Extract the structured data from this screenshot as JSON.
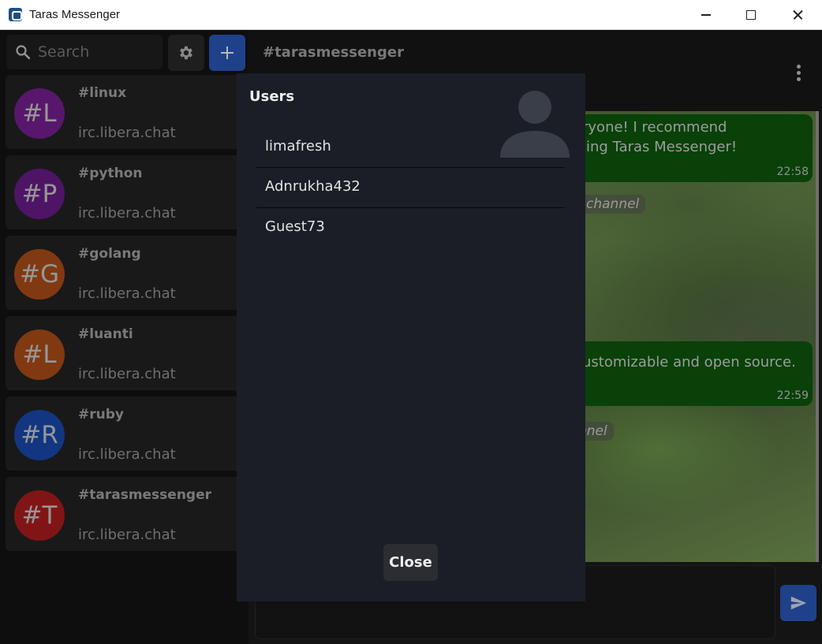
{
  "window": {
    "title": "Taras Messenger"
  },
  "sidebar": {
    "search_placeholder": "Search",
    "channels": [
      {
        "name": "#linux",
        "server": "irc.libera.chat",
        "initials": "#L",
        "color": "#7b2096"
      },
      {
        "name": "#python",
        "server": "irc.libera.chat",
        "initials": "#P",
        "color": "#6c1d8e"
      },
      {
        "name": "#golang",
        "server": "irc.libera.chat",
        "initials": "#G",
        "color": "#b34f18"
      },
      {
        "name": "#luanti",
        "server": "irc.libera.chat",
        "initials": "#L",
        "color": "#b34f18"
      },
      {
        "name": "#ruby",
        "server": "irc.libera.chat",
        "initials": "#R",
        "color": "#1a4cb3"
      },
      {
        "name": "#tarasmessenger",
        "server": "irc.libera.chat",
        "initials": "#T",
        "color": "#b31e1e"
      }
    ]
  },
  "chat": {
    "title": "#tarasmessenger",
    "messages": [
      {
        "line1": "ryone! I recommend",
        "line2": "ling Taras Messenger!",
        "time": "22:58"
      },
      {
        "line1": "ustomizable and open source.",
        "line2": "",
        "time": "22:59"
      }
    ],
    "notices": [
      "channel",
      "nnel"
    ]
  },
  "modal": {
    "title": "Users",
    "users": [
      "limafresh",
      "Adnrukha432",
      "Guest73"
    ],
    "close_label": "Close"
  },
  "colors": {
    "accent": "#2a5bbf",
    "message_bubble": "#0d5a0d",
    "modal_background": "#1b1e27"
  }
}
